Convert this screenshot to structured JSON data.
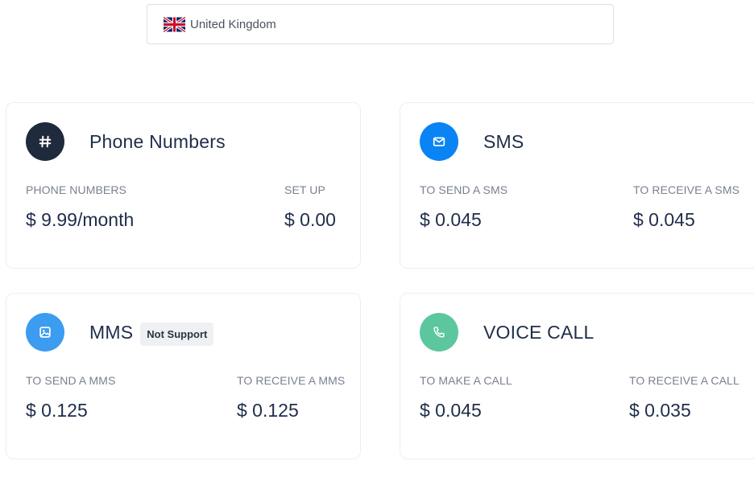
{
  "country_select": {
    "flag_icon": "uk-flag-icon",
    "value": "United Kingdom"
  },
  "cards": {
    "phone_numbers": {
      "title": "Phone Numbers",
      "icon": "hash-icon",
      "icon_color": "#1f2a3c",
      "left_label": "PHONE NUMBERS",
      "left_value": "$ 9.99/month",
      "right_label": "SET UP",
      "right_value": "$ 0.00"
    },
    "sms": {
      "title": "SMS",
      "icon": "envelope-icon",
      "icon_color": "#0a84f5",
      "left_label": "TO SEND A SMS",
      "left_value": "$ 0.045",
      "right_label": "TO RECEIVE A SMS",
      "right_value": "$ 0.045"
    },
    "mms": {
      "title": "MMS",
      "badge": "Not Support",
      "icon": "image-icon",
      "icon_color": "#3b9cf0",
      "left_label": "TO SEND A MMS",
      "left_value": "$ 0.125",
      "right_label": "TO RECEIVE A MMS",
      "right_value": "$ 0.125"
    },
    "voice_call": {
      "title": "VOICE CALL",
      "icon": "phone-icon",
      "icon_color": "#5cc79f",
      "left_label": "TO MAKE A CALL",
      "left_value": "$ 0.045",
      "right_label": "TO RECEIVE A CALL",
      "right_value": "$ 0.035"
    }
  }
}
